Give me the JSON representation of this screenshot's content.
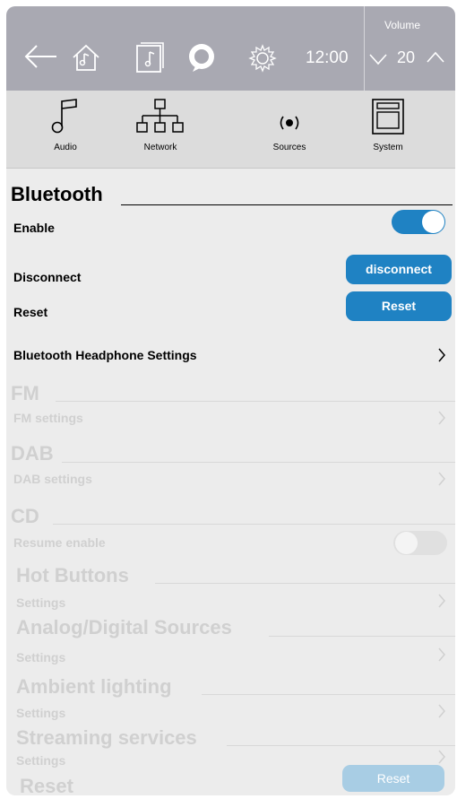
{
  "topbar": {
    "back": "back-arrow",
    "home": "home",
    "time": "12:00",
    "volume_label": "Volume",
    "volume_value": "20"
  },
  "categories": [
    {
      "label": "Audio",
      "icon": "music-note"
    },
    {
      "label": "Network",
      "icon": "network"
    },
    {
      "label": "Sources",
      "icon": "sources"
    },
    {
      "label": "System",
      "icon": "system"
    }
  ],
  "bluetooth": {
    "title": "Bluetooth",
    "enable_label": "Enable",
    "enable_state": true,
    "disconnect_label": "Disconnect",
    "disconnect_button": "disconnect",
    "reset_label": "Reset",
    "reset_button": "Reset",
    "headphone_label": "Bluetooth Headphone Settings"
  },
  "fm": {
    "title": "FM",
    "settings_label": "FM settings"
  },
  "dab": {
    "title": "DAB",
    "settings_label": "DAB settings"
  },
  "cd": {
    "title": "CD",
    "resume_label": "Resume enable",
    "resume_state": false
  },
  "hot_buttons": {
    "title": "Hot Buttons",
    "settings_label": "Settings"
  },
  "analog": {
    "title": "Analog/Digital Sources",
    "settings_label": "Settings"
  },
  "ambient": {
    "title": "Ambient lighting",
    "settings_label": "Settings"
  },
  "streaming": {
    "title": "Streaming services",
    "settings_label": "Settings"
  },
  "reset_section": {
    "title": "Reset",
    "button": "Reset"
  },
  "colors": {
    "accent": "#1f82c3",
    "topbar": "#a9a9b2",
    "background": "#ececec",
    "faded": "#d0d0d0"
  }
}
